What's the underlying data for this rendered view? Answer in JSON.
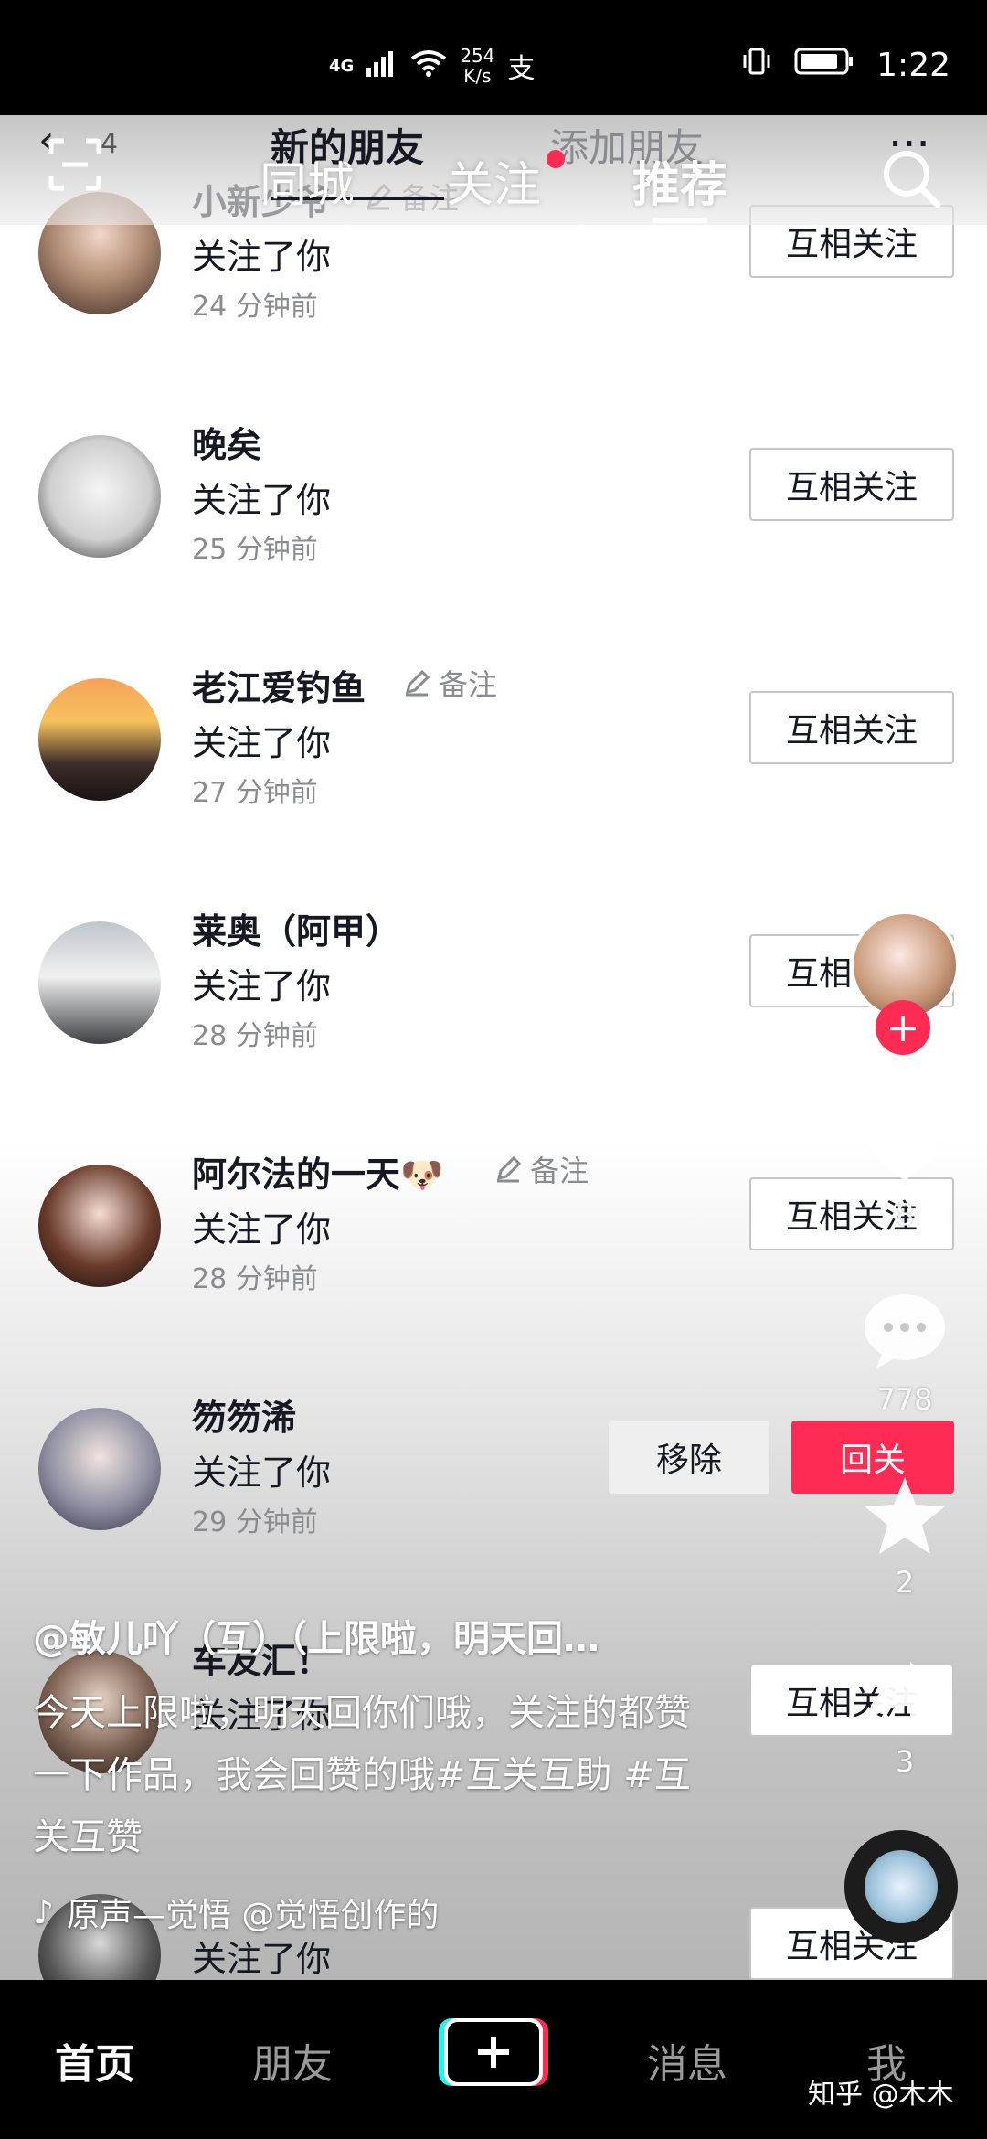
{
  "status_bar": {
    "network": "4G",
    "speed_value": "254",
    "speed_unit": "K/s",
    "extra_icon": "支",
    "time": "1:22"
  },
  "header": {
    "back_badge": "4",
    "title": "新的朋友",
    "add_friends": "添加朋友",
    "more": "···"
  },
  "feed_tabs": [
    "同城",
    "关注",
    "推荐"
  ],
  "rows": [
    {
      "name": "小新少爷",
      "remark": "备注",
      "action": "关注了你",
      "time": "24 分钟前",
      "button": "互相关注"
    },
    {
      "name": "晚矣",
      "remark": "",
      "action": "关注了你",
      "time": "25 分钟前",
      "button": "互相关注"
    },
    {
      "name": "老江爱钓鱼",
      "remark": "备注",
      "action": "关注了你",
      "time": "27 分钟前",
      "button": "互相关注"
    },
    {
      "name": "莱奥（阿甲）",
      "remark": "",
      "action": "关注了你",
      "time": "28 分钟前",
      "button": "互相关注"
    },
    {
      "name": "阿尔法的一天🐶",
      "remark": "备注",
      "action": "关注了你",
      "time": "28 分钟前",
      "button": "互相关注"
    },
    {
      "name": "笏笏浠",
      "remark": "",
      "action": "关注了你",
      "time": "29 分钟前",
      "remove": "移除",
      "button": "回关"
    },
    {
      "name": "车友汇！",
      "remark": "",
      "action": "关注了你",
      "time": "",
      "button": "互相关注"
    },
    {
      "name": "",
      "remark": "",
      "action": "关注了你",
      "time": "",
      "button": "互相关注"
    }
  ],
  "rail": {
    "like_count": "8",
    "comment_count": "778",
    "favorite_count": "2",
    "share_count": "3"
  },
  "video": {
    "author": "@敏儿吖（互）（上限啦，明天回…",
    "caption": "今天上限啦，明天回你们哦，关注的都赞一下作品，我会回赞的哦#互关互助 #互关互赞",
    "music": "原声—觉悟    @觉悟创作的"
  },
  "bottom_nav": [
    "首页",
    "朋友",
    "消息",
    "我"
  ],
  "watermark": "知乎 @木木",
  "colors": {
    "accent": "#fe2c55",
    "text_primary": "#161823",
    "text_secondary": "#8a8b91"
  }
}
